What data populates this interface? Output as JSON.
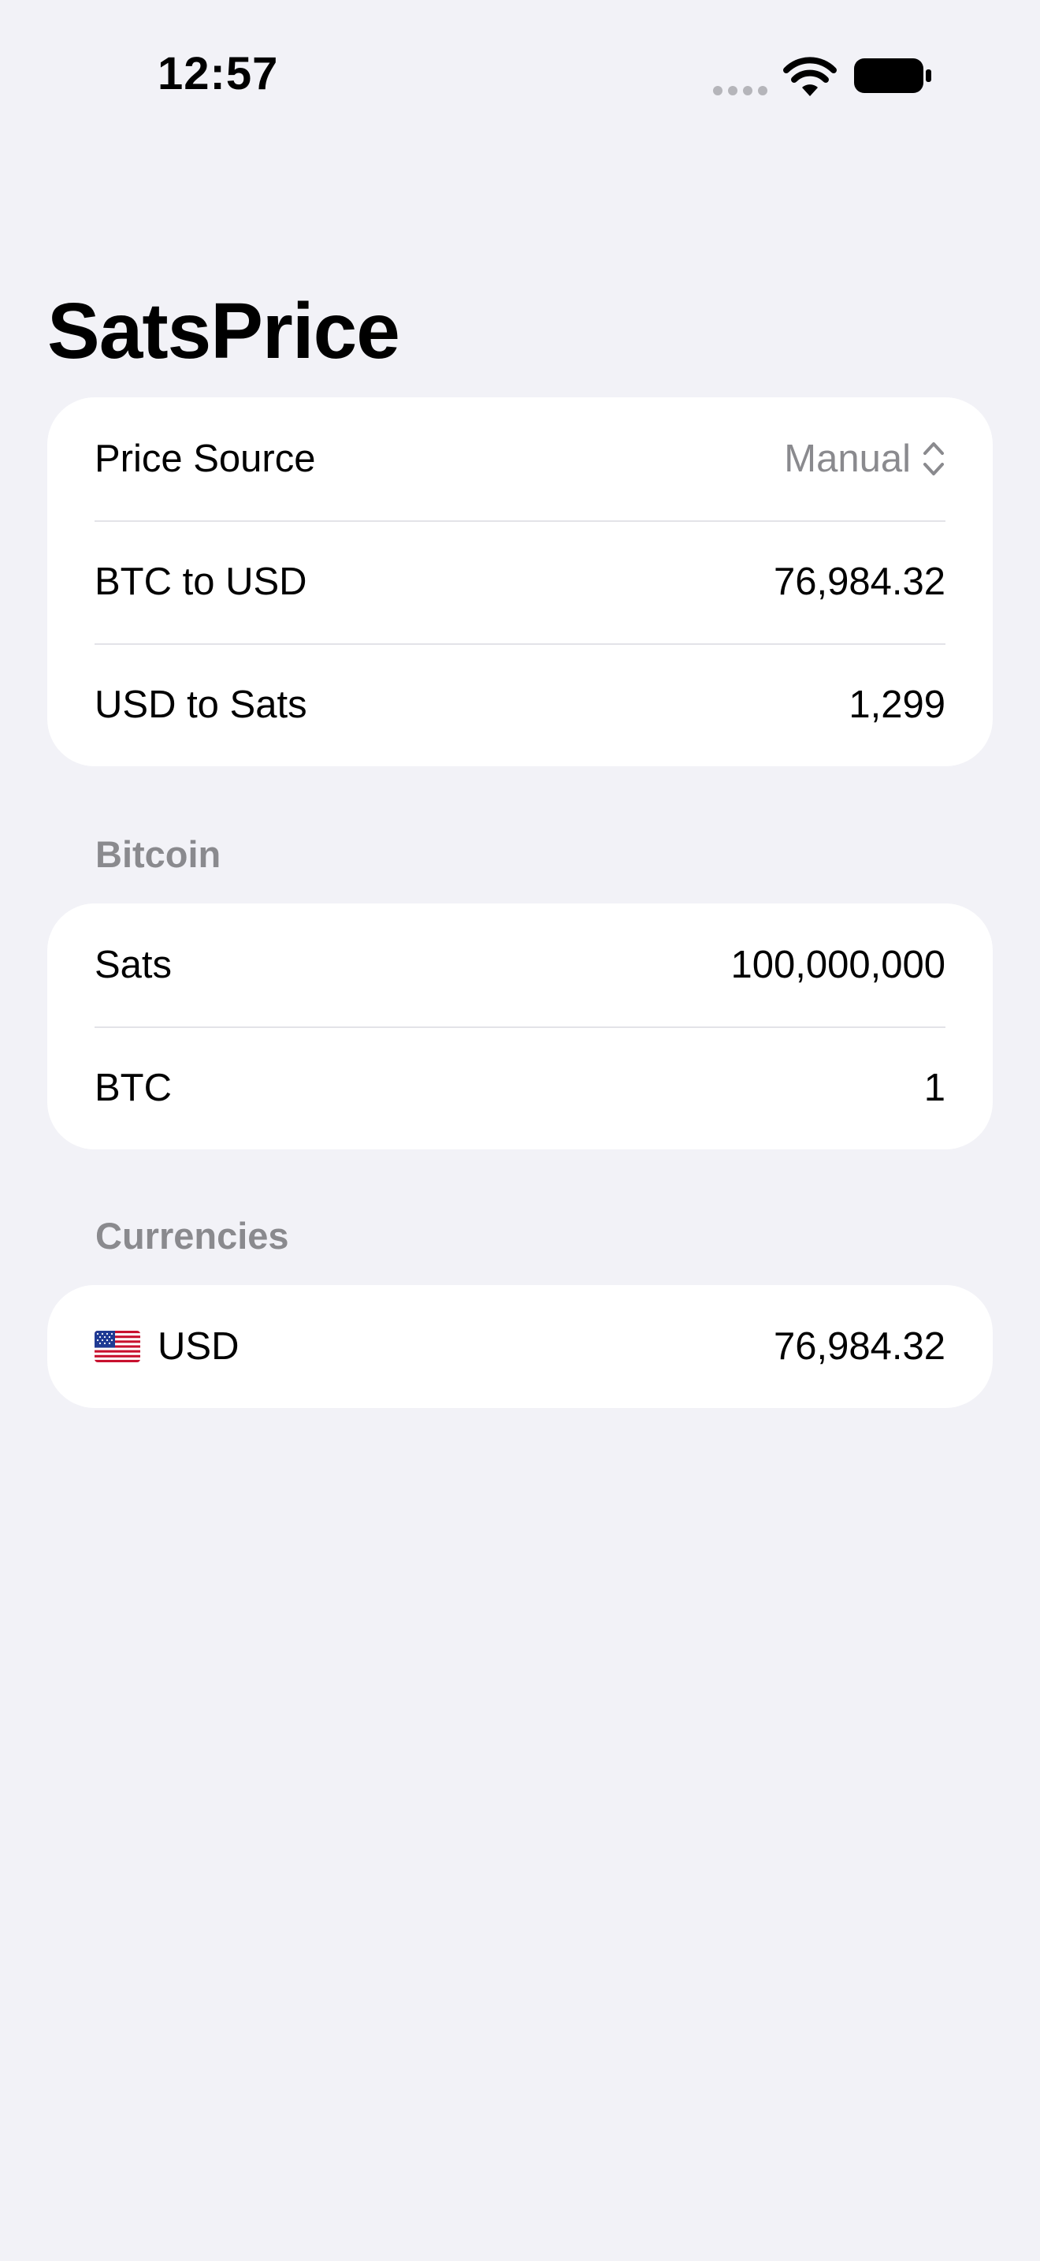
{
  "status_bar": {
    "time": "12:57"
  },
  "title": "SatsPrice",
  "settings": {
    "price_source_label": "Price Source",
    "price_source_value": "Manual",
    "btc_to_usd_label": "BTC to USD",
    "btc_to_usd_value": "76,984.32",
    "usd_to_sats_label": "USD to Sats",
    "usd_to_sats_value": "1,299"
  },
  "bitcoin": {
    "header": "Bitcoin",
    "sats_label": "Sats",
    "sats_value": "100,000,000",
    "btc_label": "BTC",
    "btc_value": "1"
  },
  "currencies": {
    "header": "Currencies",
    "items": [
      {
        "flag": "us-flag-icon",
        "code": "USD",
        "value": "76,984.32"
      }
    ]
  },
  "colors": {
    "background": "#f2f2f7",
    "card": "#ffffff",
    "secondary_text": "#8a8a8e",
    "separator": "#e3e3e8"
  }
}
